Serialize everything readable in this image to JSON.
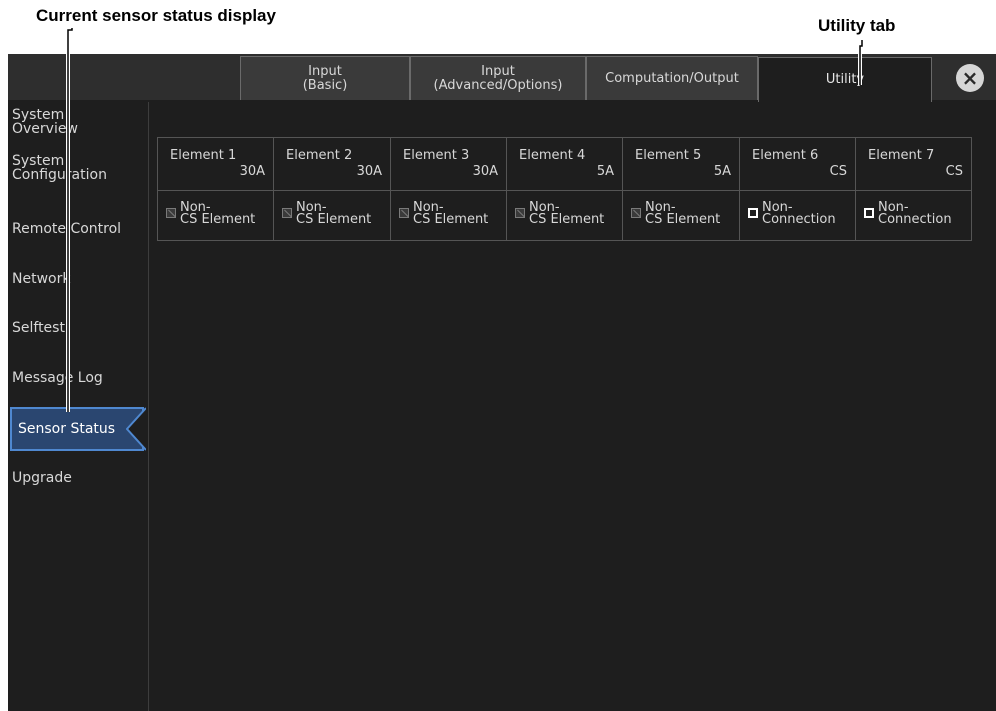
{
  "callouts": {
    "left": "Current sensor status display",
    "right": "Utility tab"
  },
  "tabs": [
    {
      "line1": "Input",
      "line2": "(Basic)"
    },
    {
      "line1": "Input",
      "line2": "(Advanced/Options)"
    },
    {
      "line1": "Computation/Output",
      "line2": ""
    },
    {
      "line1": "Utility",
      "line2": ""
    }
  ],
  "close_icon": "×",
  "sidebar": {
    "items": [
      {
        "line1": "System",
        "line2": "Overview"
      },
      {
        "line1": "System",
        "line2": "Configuration"
      },
      {
        "line1": "Remote Control",
        "line2": ""
      },
      {
        "line1": "Network",
        "line2": ""
      },
      {
        "line1": "Selftest",
        "line2": ""
      },
      {
        "line1": "Message Log",
        "line2": ""
      },
      {
        "line1": "Sensor Status",
        "line2": ""
      },
      {
        "line1": "Upgrade",
        "line2": ""
      }
    ],
    "active": "Sensor Status"
  },
  "elements": [
    {
      "name": "Element 1",
      "rating": "30A",
      "status1": "Non-",
      "status2": "CS Element",
      "checkbox": "disabled"
    },
    {
      "name": "Element 2",
      "rating": "30A",
      "status1": "Non-",
      "status2": "CS Element",
      "checkbox": "disabled"
    },
    {
      "name": "Element 3",
      "rating": "30A",
      "status1": "Non-",
      "status2": "CS Element",
      "checkbox": "disabled"
    },
    {
      "name": "Element 4",
      "rating": "5A",
      "status1": "Non-",
      "status2": "CS Element",
      "checkbox": "disabled"
    },
    {
      "name": "Element 5",
      "rating": "5A",
      "status1": "Non-",
      "status2": "CS Element",
      "checkbox": "disabled"
    },
    {
      "name": "Element 6",
      "rating": "CS",
      "status1": "Non-",
      "status2": "Connection",
      "checkbox": "unchecked"
    },
    {
      "name": "Element 7",
      "rating": "CS",
      "status1": "Non-",
      "status2": "Connection",
      "checkbox": "unchecked"
    }
  ]
}
